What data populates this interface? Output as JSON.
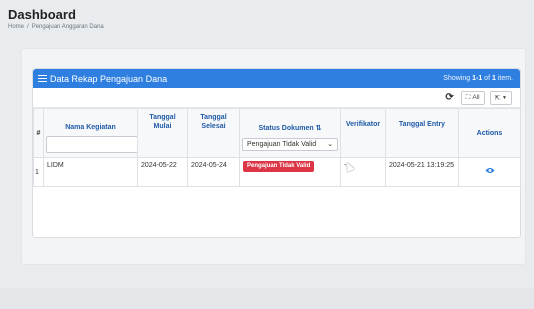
{
  "page": {
    "title": "Dashboard",
    "breadcrumb": [
      "Home",
      "Pengajuan Anggaran Dana"
    ]
  },
  "panel": {
    "title": "Data Rekap Pengajuan Dana",
    "summary_prefix": "Showing",
    "summary_range": "1-1",
    "summary_of": "of",
    "summary_total": "1",
    "summary_suffix": "item.",
    "toolbar": {
      "all_label": "All"
    }
  },
  "table": {
    "headers": {
      "number": "#",
      "nama_kegiatan": "Nama Kegiatan",
      "tanggal_mulai": "Tanggal Mulai",
      "tanggal_selesai": "Tanggal Selesai",
      "status_dokumen": "Status Dokumen",
      "verifikator": "Verifikator",
      "tanggal_entry": "Tanggal Entry",
      "actions": "Actions"
    },
    "filters": {
      "nama_kegiatan_value": "",
      "status_selected": "Pengajuan Tidak Valid"
    },
    "rows": [
      {
        "number": "1",
        "nama_kegiatan": "LIDM",
        "tanggal_mulai": "2024-05-22",
        "tanggal_selesai": "2024-05-24",
        "status": "Pengajuan Tidak Valid",
        "verifikator": "-",
        "tanggal_entry": "2024-05-21 13:19:25"
      }
    ]
  },
  "colors": {
    "heading_bg": "#2f7fe0",
    "header_text": "#1f5aa6",
    "danger_badge": "#dc3545"
  },
  "icons": {
    "title": "list-icon",
    "refresh": "refresh-icon",
    "toggle_all": "expand-icon",
    "export": "export-icon",
    "sort": "sort-icon",
    "view": "eye-icon"
  }
}
